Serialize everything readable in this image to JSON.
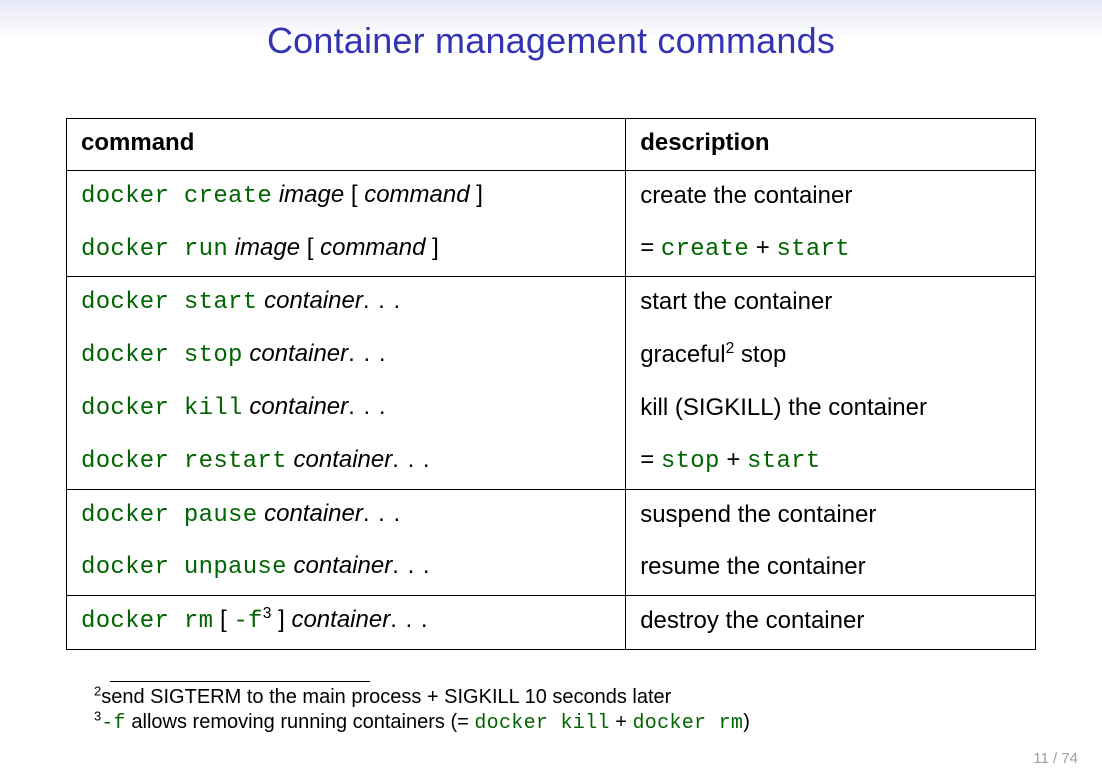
{
  "title": "Container management commands",
  "headers": {
    "command": "command",
    "description": "description"
  },
  "rows": [
    {
      "cmd": {
        "tt": "docker create",
        "var": "image",
        "bracket": "command"
      },
      "desc": {
        "plain": "create the container"
      }
    },
    {
      "cmd": {
        "tt": "docker run",
        "var": "image",
        "bracket": "command"
      },
      "desc": {
        "eq": true,
        "ttA": "create",
        "plus": true,
        "ttB": "start"
      }
    },
    {
      "cmd": {
        "tt": "docker start",
        "var": "container",
        "dots": true
      },
      "desc": {
        "plain": "start the container"
      }
    },
    {
      "cmd": {
        "tt": "docker stop",
        "var": "container",
        "dots": true
      },
      "desc": {
        "plainPre": "graceful",
        "sup": "2",
        "plainPost": " stop"
      }
    },
    {
      "cmd": {
        "tt": "docker kill",
        "var": "container",
        "dots": true
      },
      "desc": {
        "plain": "kill (SIGKILL) the container"
      }
    },
    {
      "cmd": {
        "tt": "docker restart",
        "var": "container",
        "dots": true
      },
      "desc": {
        "eq": true,
        "ttA": "stop",
        "plus": true,
        "ttB": "start"
      }
    },
    {
      "cmd": {
        "tt": "docker pause",
        "var": "container",
        "dots": true
      },
      "desc": {
        "plain": "suspend the container"
      }
    },
    {
      "cmd": {
        "tt": "docker unpause",
        "var": "container",
        "dots": true
      },
      "desc": {
        "plain": "resume the container"
      }
    },
    {
      "cmd": {
        "tt": "docker rm",
        "flag": "-f",
        "flagSup": "3",
        "var": "container",
        "dots": true,
        "flagBracket": true
      },
      "desc": {
        "plain": "destroy the container"
      }
    }
  ],
  "row_groups": [
    [
      0,
      1
    ],
    [
      2,
      3,
      4,
      5
    ],
    [
      6,
      7
    ],
    [
      8
    ]
  ],
  "footnotes": {
    "fn2_sup": "2",
    "fn2_text": "send SIGTERM to the main process + SIGKILL 10 seconds later",
    "fn3_sup": "3",
    "fn3_ttA": "-f",
    "fn3_mid": " allows removing running containers (= ",
    "fn3_ttB": "docker kill",
    "fn3_plus": " + ",
    "fn3_ttC": "docker rm",
    "fn3_end": ")"
  },
  "page": "11 / 74"
}
